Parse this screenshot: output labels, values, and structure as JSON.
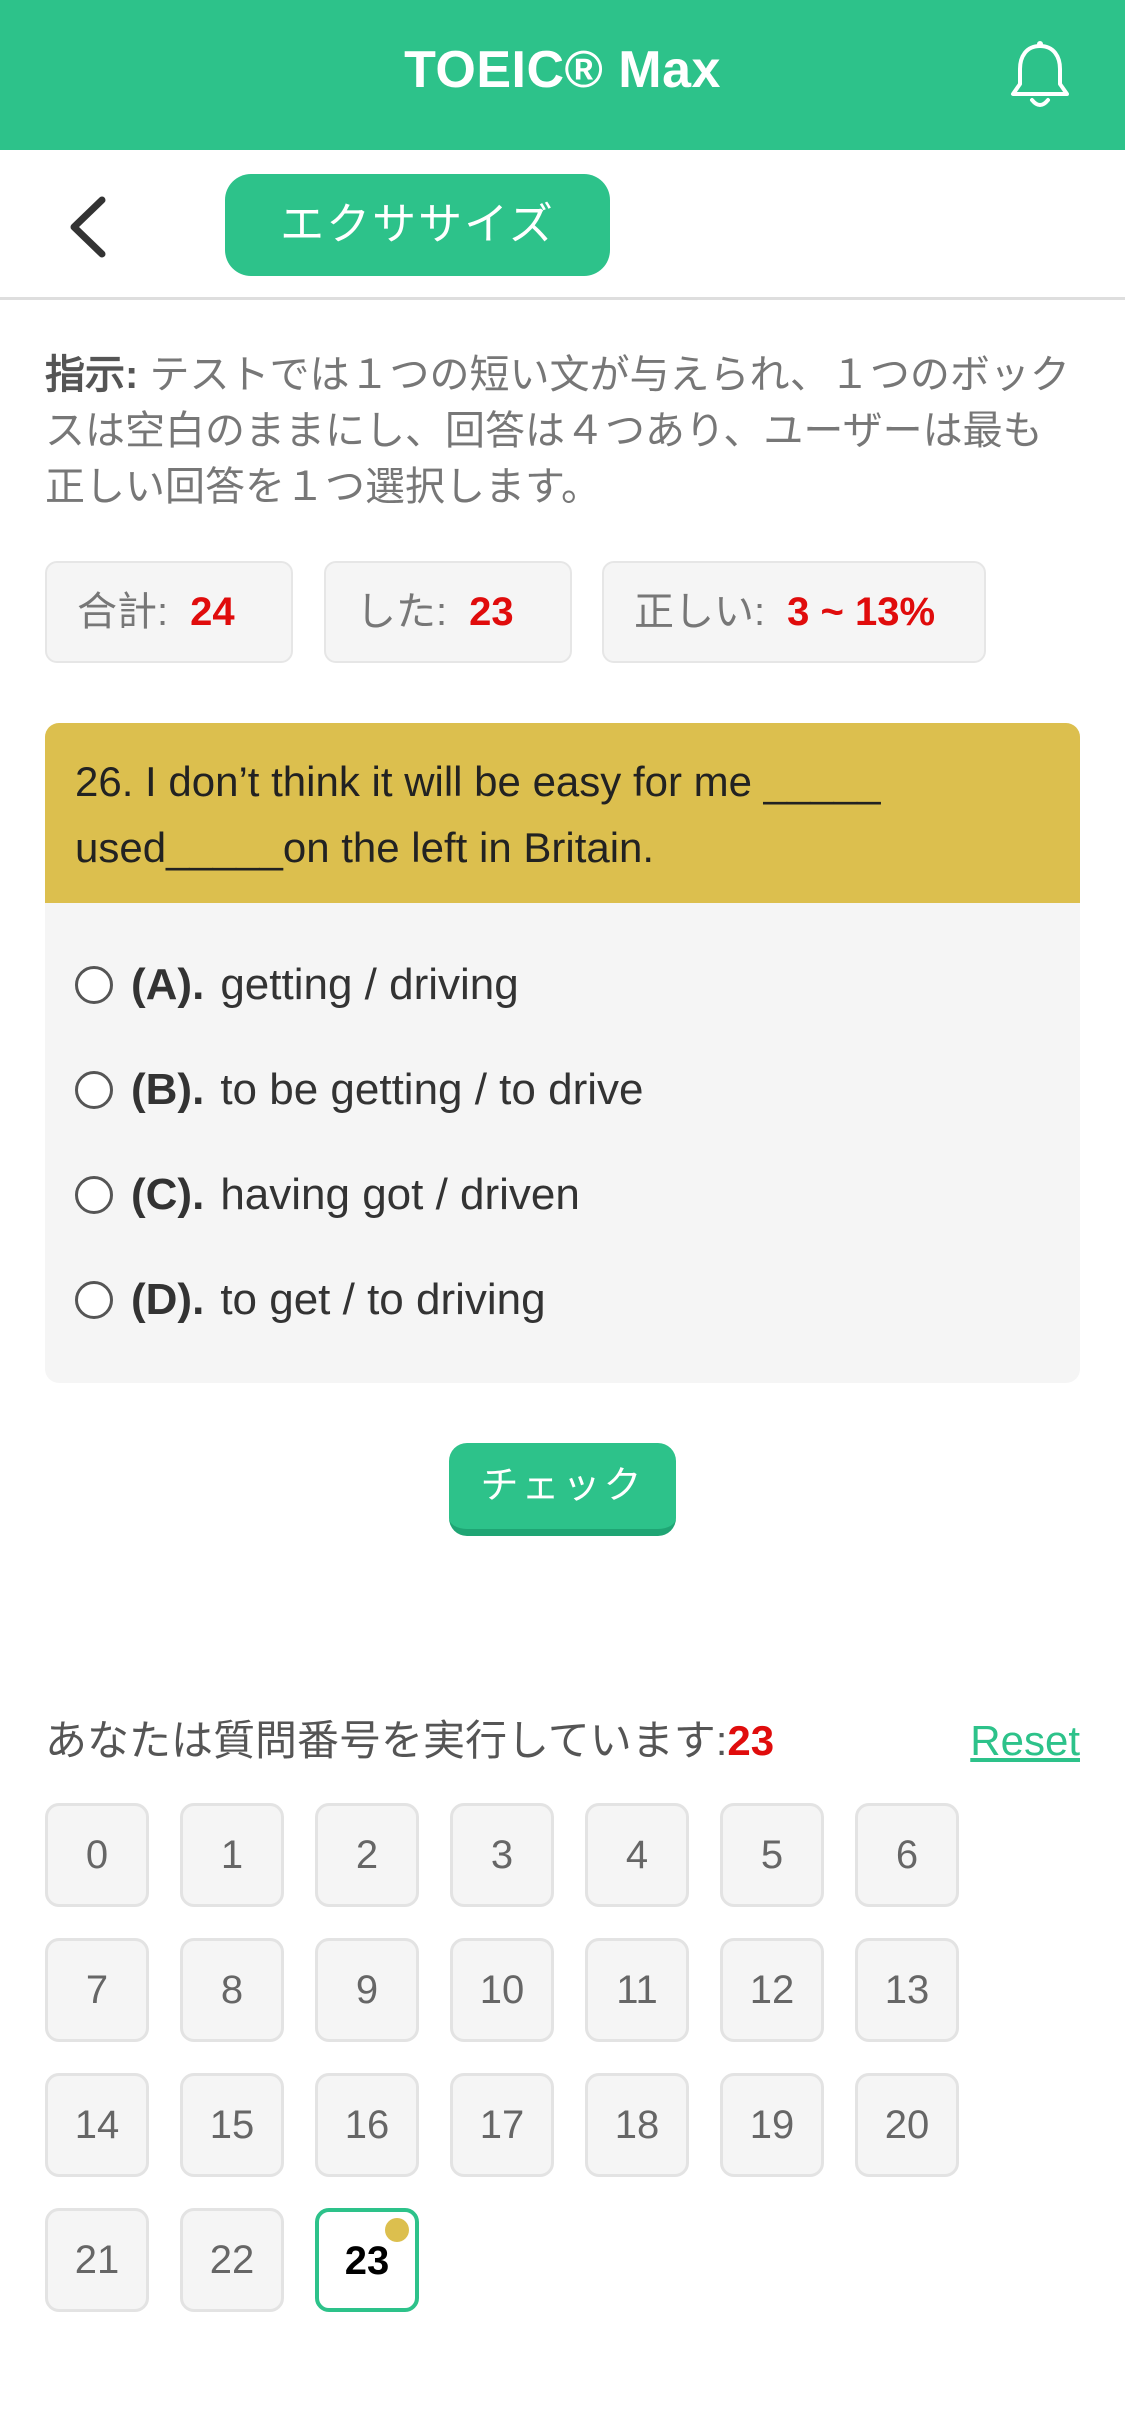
{
  "header": {
    "title": "TOEIC® Max",
    "bell_icon": "bell-icon"
  },
  "nav": {
    "back_icon": "chevron-left-icon",
    "tab_label": "エクササイズ"
  },
  "instruction": {
    "label": "指示:",
    "text": " テストでは１つの短い文が与えられ、１つのボックスは空白のままにし、回答は４つあり、ユーザーは最も正しい回答を１つ選択します。"
  },
  "stats": [
    {
      "label": "合計:",
      "value": "24"
    },
    {
      "label": "した:",
      "value": "23"
    },
    {
      "label": "正しい:",
      "value": "3 ~ 13%"
    }
  ],
  "question": {
    "text": "26. I don’t think it will be easy for me _____ used_____on the left in Britain."
  },
  "options": [
    {
      "letter": "(A).",
      "text": "getting / driving"
    },
    {
      "letter": "(B).",
      "text": "to be getting / to drive"
    },
    {
      "letter": "(C).",
      "text": "having got / driven"
    },
    {
      "letter": "(D).",
      "text": "to get / to driving"
    }
  ],
  "check_label": "チェック",
  "progress": {
    "label": "あなたは質問番号を実行しています:",
    "current": "23",
    "reset_label": "Reset"
  },
  "question_numbers": [
    "0",
    "1",
    "2",
    "3",
    "4",
    "5",
    "6",
    "7",
    "8",
    "9",
    "10",
    "11",
    "12",
    "13",
    "14",
    "15",
    "16",
    "17",
    "18",
    "19",
    "20",
    "21",
    "22",
    "23"
  ],
  "colors": {
    "primary": "#2dc28a",
    "question_bg": "#dcbf4e",
    "accent_red": "#e00c0c"
  }
}
